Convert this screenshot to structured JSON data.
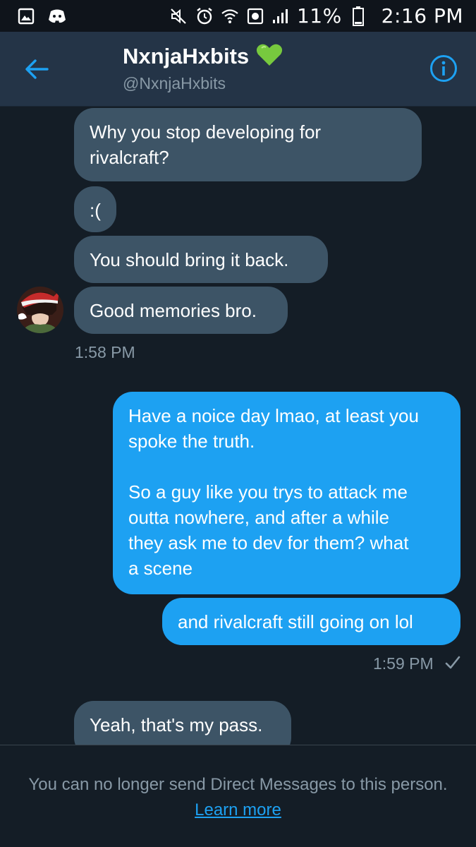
{
  "status_bar": {
    "battery_percent": "11%",
    "time": "2:16 PM",
    "icons": [
      "gallery-icon",
      "discord-icon",
      "mute-icon",
      "alarm-icon",
      "wifi-icon",
      "data-saver-icon",
      "signal-icon",
      "battery-icon"
    ]
  },
  "header": {
    "display_name": "NxnjaHxbits",
    "handle": "@NxnjaHxbits",
    "name_emoji": "green-heart-icon",
    "back_icon": "back-arrow-icon",
    "info_icon": "info-icon"
  },
  "messages": {
    "m1": "Why you stop developing for\nrivalcraft?",
    "m2": ":(",
    "m3": "You should bring it back.",
    "m4": "Good memories bro.",
    "time1": "1:58 PM",
    "m5": "Have a noice day lmao, at least you\nspoke the truth.\n\nSo a guy like you trys to attack me\noutta nowhere, and after a while\nthey ask me to dev for them? what\na scene",
    "m6": "and rivalcraft still going on lol",
    "time2": "1:59 PM",
    "read_icon": "checkmark-icon",
    "m7": "Yeah, that's my pass."
  },
  "footer": {
    "notice": "You can no longer send Direct Messages to this person.",
    "link": "Learn more"
  },
  "colors": {
    "background": "#141d26",
    "header": "#243447",
    "incoming_bubble": "#3d5466",
    "outgoing_bubble": "#1da1f2",
    "accent": "#1da1f2",
    "muted_text": "#8899a6"
  }
}
